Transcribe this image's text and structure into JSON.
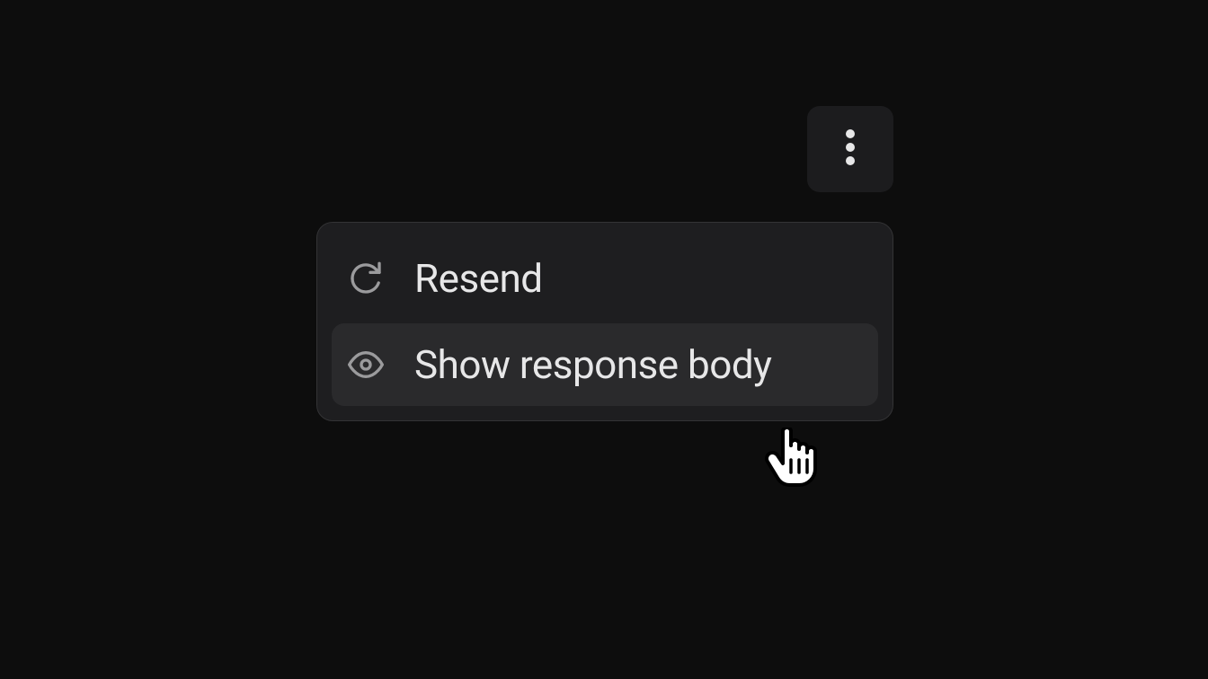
{
  "menu": {
    "items": [
      {
        "label": "Resend"
      },
      {
        "label": "Show response body"
      }
    ]
  }
}
